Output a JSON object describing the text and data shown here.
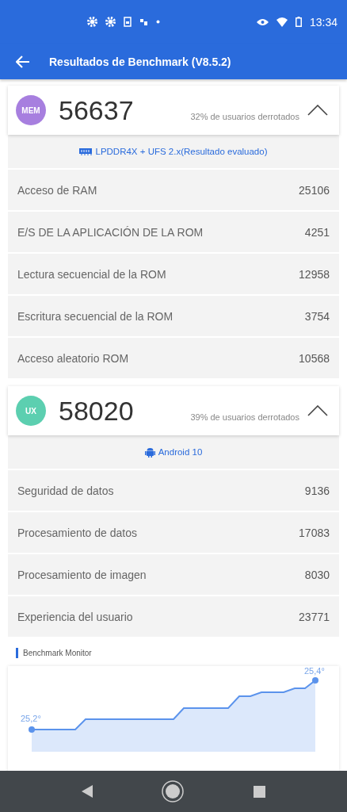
{
  "status_bar": {
    "time": "13:34"
  },
  "app_bar": {
    "title": "Resultados de Benchmark (V8.5.2)"
  },
  "sections": [
    {
      "kind": "memory",
      "badge": "MEM",
      "color": "#a77fdf",
      "score": "56637",
      "defeated": "32% de usuarios derrotados",
      "expanded": true,
      "subtitle": "LPDDR4X + UFS 2.x(Resultado evaluado)",
      "rows": [
        {
          "label": "Acceso de RAM",
          "value": "25106"
        },
        {
          "label": "E/S DE LA APLICACIÓN DE LA ROM",
          "value": "4251"
        },
        {
          "label": "Lectura secuencial de la ROM",
          "value": "12958"
        },
        {
          "label": "Escritura secuencial de la ROM",
          "value": "3754"
        },
        {
          "label": "Acceso aleatorio ROM",
          "value": "10568"
        }
      ]
    },
    {
      "kind": "android",
      "badge": "UX",
      "color": "#5ccfb0",
      "score": "58020",
      "defeated": "39% de usuarios derrotados",
      "expanded": true,
      "subtitle": "Android 10",
      "rows": [
        {
          "label": "Seguridad de datos",
          "value": "9136"
        },
        {
          "label": "Procesamiento de datos",
          "value": "17083"
        },
        {
          "label": "Procesamiento de imagen",
          "value": "8030"
        },
        {
          "label": "Experiencia del usuario",
          "value": "23771"
        }
      ]
    }
  ],
  "monitor": {
    "title": "Benchmark Monitor",
    "start_label": "25,2°",
    "end_label": "25,4°"
  }
}
